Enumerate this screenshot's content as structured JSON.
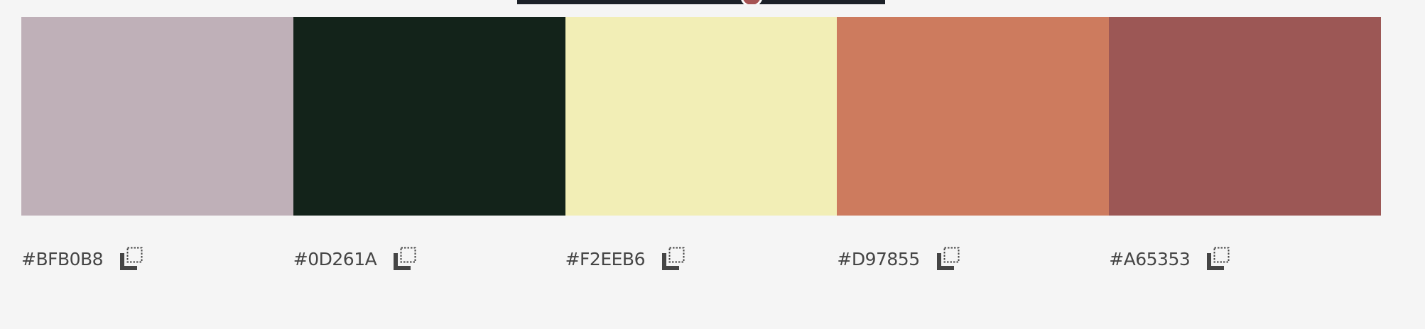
{
  "palette": {
    "swatches": [
      {
        "hex": "#BFB0B8",
        "color": "#BFB0B8"
      },
      {
        "hex": "#0D261A",
        "color": "#13231A"
      },
      {
        "hex": "#F2EEB6",
        "color": "#F2EEB6"
      },
      {
        "hex": "#D97855",
        "color": "#CD7B5E"
      },
      {
        "hex": "#A65353",
        "color": "#9C5755"
      }
    ]
  },
  "icons": {
    "copy": "copy-icon"
  }
}
